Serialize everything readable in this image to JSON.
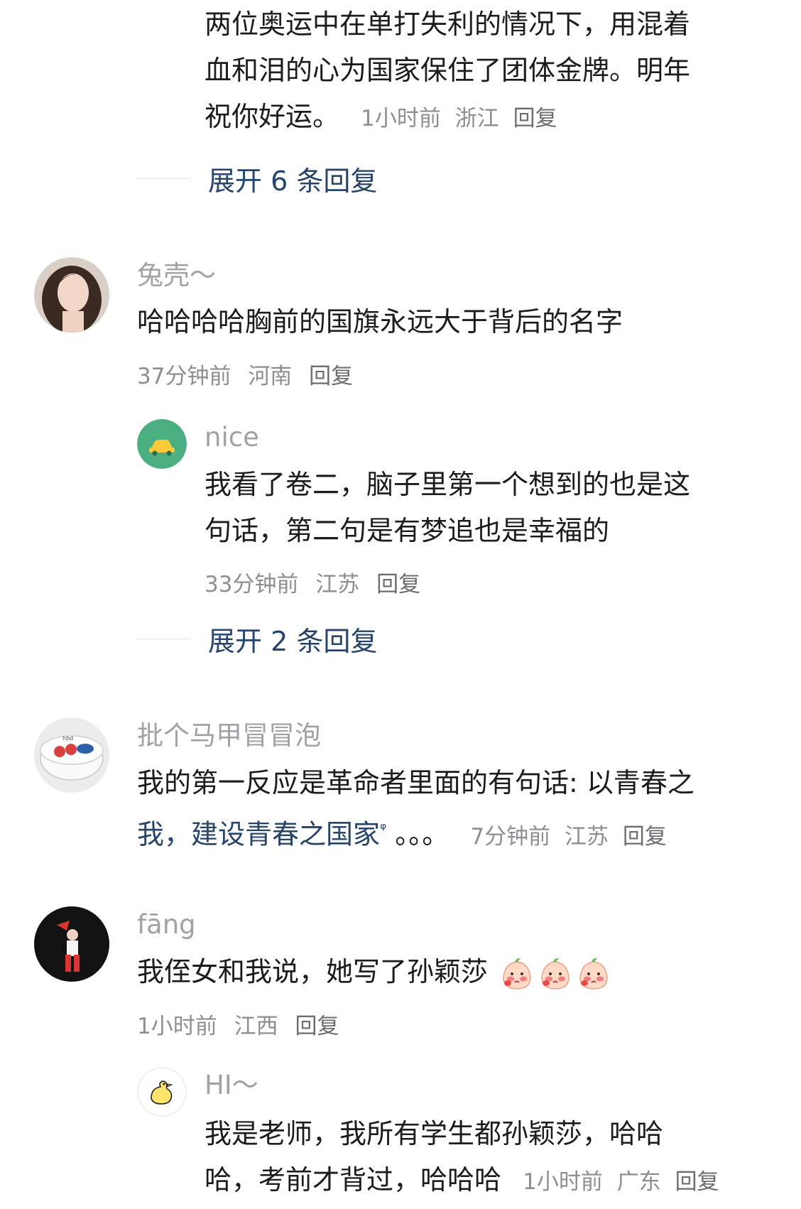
{
  "comments": {
    "c0": {
      "text_lines": [
        "两位奥运中在单打失利的情况下，用混着",
        "血和泪的心为国家保住了团体金牌。明年",
        "祝你好运。"
      ],
      "time": "1小时前",
      "location": "浙江",
      "reply": "回复",
      "expand": "展开 6 条回复"
    },
    "c1": {
      "username": "兔壳～",
      "text": "哈哈哈哈胸前的国旗永远大于背后的名字",
      "time": "37分钟前",
      "location": "河南",
      "reply": "回复",
      "sub": {
        "username": "nice",
        "text_lines": [
          "我看了卷二，脑子里第一个想到的也是这",
          "句话，第二句是有梦追也是幸福的"
        ],
        "time": "33分钟前",
        "location": "江苏",
        "reply": "回复"
      },
      "expand": "展开 2 条回复"
    },
    "c2": {
      "username": "批个马甲冒冒泡",
      "text_lines": [
        "我的第一反应是革命者里面的有句话: 以青春之",
        "我，建设青春之国家"
      ],
      "search_marker": "ᵠ",
      "ellipsis": "。。。",
      "time": "7分钟前",
      "location": "江苏",
      "reply": "回复"
    },
    "c3": {
      "username": "fāng",
      "text": "我侄女和我说，她写了孙颖莎",
      "time": "1小时前",
      "location": "江西",
      "reply": "回复",
      "sub": {
        "username": "HI～",
        "text_lines": [
          "我是老师，我所有学生都孙颖莎，哈哈",
          "哈，考前才背过，哈哈哈"
        ],
        "time": "1小时前",
        "location": "广东",
        "reply": "回复"
      }
    }
  },
  "icons": {
    "emoji": "peach-blush-emoji",
    "avatar_nice": "car-icon",
    "avatar_hi": "duck-icon"
  },
  "colors": {
    "text": "#1c1c1e",
    "meta": "#8e8e93",
    "username": "#a2a2a6",
    "expand": "#27446b",
    "nice_avatar_bg": "#4caf82"
  }
}
